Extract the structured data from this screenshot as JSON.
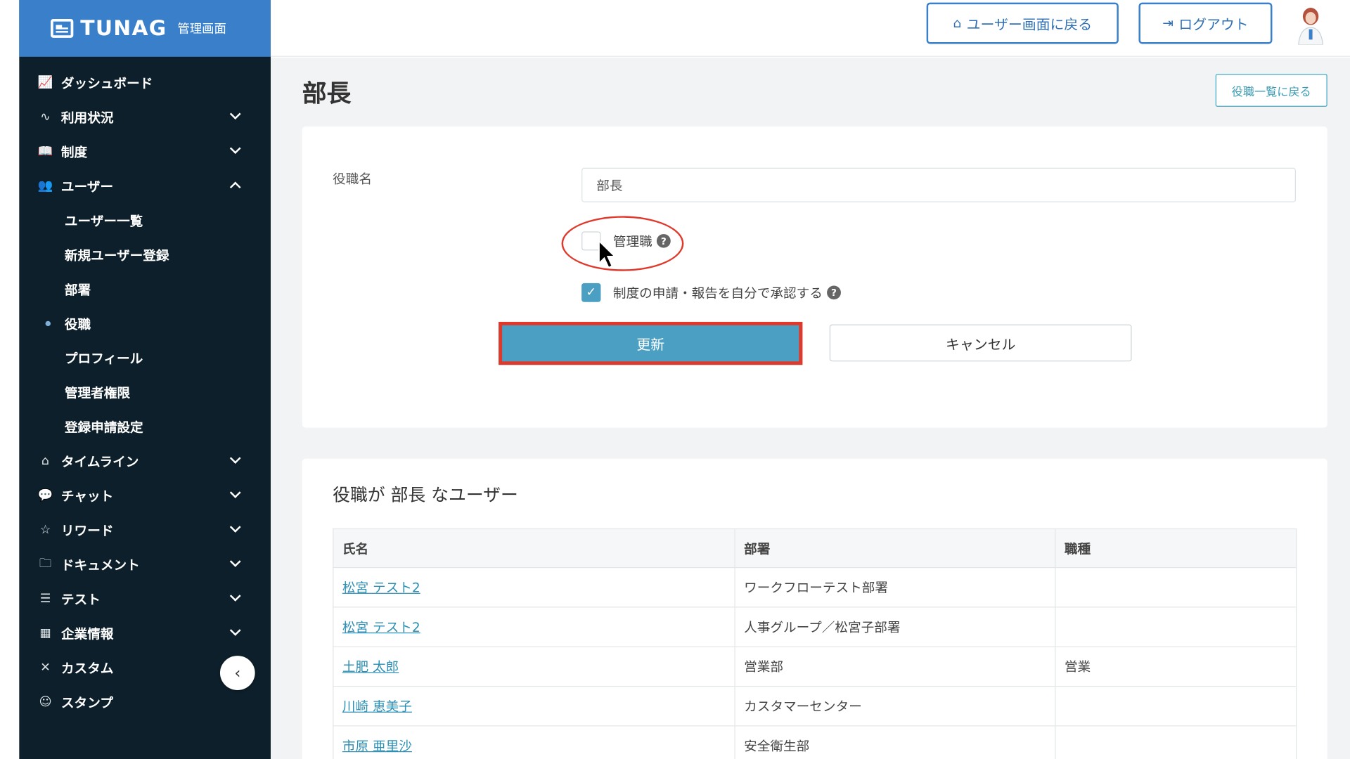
{
  "brand": {
    "name": "TUNAG",
    "sub": "管理画面"
  },
  "sidebar": {
    "items": [
      {
        "label": "ダッシュボード",
        "icon": "chart-icon"
      },
      {
        "label": "利用状況",
        "icon": "activity-icon"
      },
      {
        "label": "制度",
        "icon": "book-icon"
      },
      {
        "label": "ユーザー",
        "icon": "users-icon"
      },
      {
        "label": "タイムライン",
        "icon": "home-icon"
      },
      {
        "label": "チャット",
        "icon": "chat-icon"
      },
      {
        "label": "リワード",
        "icon": "star-icon"
      },
      {
        "label": "ドキュメント",
        "icon": "folder-icon"
      },
      {
        "label": "テスト",
        "icon": "list-icon"
      },
      {
        "label": "企業情報",
        "icon": "building-icon"
      },
      {
        "label": "カスタム",
        "icon": "tools-icon"
      },
      {
        "label": "スタンプ",
        "icon": "smile-icon"
      }
    ],
    "user_sub_items": [
      {
        "label": "ユーザー一覧"
      },
      {
        "label": "新規ユーザー登録"
      },
      {
        "label": "部署"
      },
      {
        "label": "役職",
        "active": true
      },
      {
        "label": "プロフィール"
      },
      {
        "label": "管理者権限"
      },
      {
        "label": "登録申請設定"
      }
    ]
  },
  "header": {
    "back_to_user": "ユーザー画面に戻る",
    "logout": "ログアウト"
  },
  "main": {
    "title": "部長",
    "back_to_list": "役職一覧に戻る",
    "form": {
      "name_label": "役職名",
      "name_value": "部長",
      "manager_label": "管理職",
      "manager_checked": false,
      "self_approve_label": "制度の申請・報告を自分で承認する",
      "self_approve_checked": true,
      "update_button": "更新",
      "cancel_button": "キャンセル"
    },
    "users": {
      "title": "役職が 部長 なユーザー",
      "columns": [
        "氏名",
        "部署",
        "職種"
      ],
      "rows": [
        {
          "name": "松宮 テスト2",
          "dept": "ワークフローテスト部署",
          "job": ""
        },
        {
          "name": "松宮 テスト2",
          "dept": "人事グループ／松宮子部署",
          "job": ""
        },
        {
          "name": "土肥 太郎",
          "dept": "営業部",
          "job": "営業"
        },
        {
          "name": "川崎 恵美子",
          "dept": "カスタマーセンター",
          "job": ""
        },
        {
          "name": "市原 亜里沙",
          "dept": "安全衛生部",
          "job": ""
        }
      ]
    }
  },
  "colors": {
    "sidebar_bg": "#0d1f2a",
    "brand_bg": "#3a7fc9",
    "accent": "#4a9fc3",
    "highlight": "#e0392b"
  }
}
